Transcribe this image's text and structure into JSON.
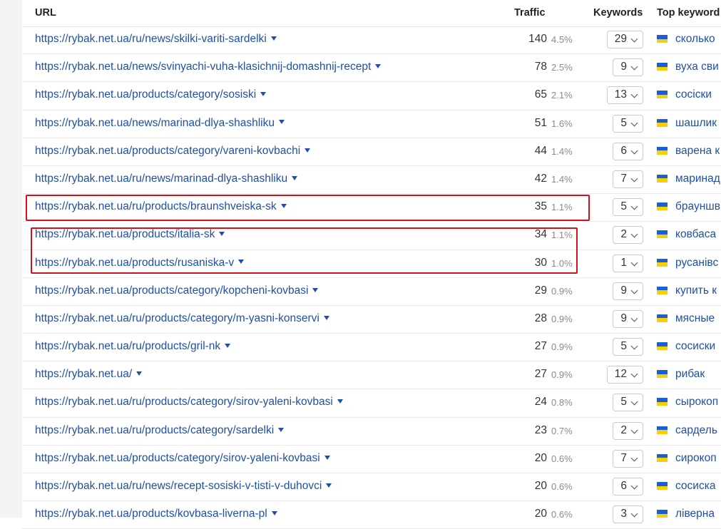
{
  "header": {
    "url": "URL",
    "traffic": "Traffic",
    "keywords": "Keywords",
    "top_keyword": "Top keyword"
  },
  "colors": {
    "link": "#1f4fa8",
    "highlight": "#d0121b",
    "flag_blue": "#1b5fd6",
    "flag_yellow": "#f7d000"
  },
  "rows": [
    {
      "url": "https://rybak.net.ua/ru/news/skilki-variti-sardelki",
      "traffic": "140",
      "pct": "4.5%",
      "keywords": "29",
      "top_keyword": "сколько"
    },
    {
      "url": "https://rybak.net.ua/news/svinyachi-vuha-klasichnij-domashnij-recept",
      "traffic": "78",
      "pct": "2.5%",
      "keywords": "9",
      "top_keyword": "вуха сви"
    },
    {
      "url": "https://rybak.net.ua/products/category/sosiski",
      "traffic": "65",
      "pct": "2.1%",
      "keywords": "13",
      "top_keyword": "сосіски"
    },
    {
      "url": "https://rybak.net.ua/news/marinad-dlya-shashliku",
      "traffic": "51",
      "pct": "1.6%",
      "keywords": "5",
      "top_keyword": "шашлик"
    },
    {
      "url": "https://rybak.net.ua/products/category/vareni-kovbachi",
      "traffic": "44",
      "pct": "1.4%",
      "keywords": "6",
      "top_keyword": "варена к"
    },
    {
      "url": "https://rybak.net.ua/ru/news/marinad-dlya-shashliku",
      "traffic": "42",
      "pct": "1.4%",
      "keywords": "7",
      "top_keyword": "маринад"
    },
    {
      "url": "https://rybak.net.ua/ru/products/braunshveiska-sk",
      "traffic": "35",
      "pct": "1.1%",
      "keywords": "5",
      "top_keyword": "брауншв"
    },
    {
      "url": "https://rybak.net.ua/products/italia-sk",
      "traffic": "34",
      "pct": "1.1%",
      "keywords": "2",
      "top_keyword": "ковбаса"
    },
    {
      "url": "https://rybak.net.ua/products/rusaniska-v",
      "traffic": "30",
      "pct": "1.0%",
      "keywords": "1",
      "top_keyword": "русанівс"
    },
    {
      "url": "https://rybak.net.ua/products/category/kopcheni-kovbasi",
      "traffic": "29",
      "pct": "0.9%",
      "keywords": "9",
      "top_keyword": "купить к"
    },
    {
      "url": "https://rybak.net.ua/ru/products/category/m-yasni-konservi",
      "traffic": "28",
      "pct": "0.9%",
      "keywords": "9",
      "top_keyword": "мясные"
    },
    {
      "url": "https://rybak.net.ua/ru/products/gril-nk",
      "traffic": "27",
      "pct": "0.9%",
      "keywords": "5",
      "top_keyword": "сосиски"
    },
    {
      "url": "https://rybak.net.ua/",
      "traffic": "27",
      "pct": "0.9%",
      "keywords": "12",
      "top_keyword": "рибак"
    },
    {
      "url": "https://rybak.net.ua/ru/products/category/sirov-yaleni-kovbasi",
      "traffic": "24",
      "pct": "0.8%",
      "keywords": "5",
      "top_keyword": "сырокоп"
    },
    {
      "url": "https://rybak.net.ua/ru/products/category/sardelki",
      "traffic": "23",
      "pct": "0.7%",
      "keywords": "2",
      "top_keyword": "сардель"
    },
    {
      "url": "https://rybak.net.ua/products/category/sirov-yaleni-kovbasi",
      "traffic": "20",
      "pct": "0.6%",
      "keywords": "7",
      "top_keyword": "сирокоп"
    },
    {
      "url": "https://rybak.net.ua/ru/news/recept-sosiski-v-tisti-v-duhovci",
      "traffic": "20",
      "pct": "0.6%",
      "keywords": "6",
      "top_keyword": "сосиска"
    },
    {
      "url": "https://rybak.net.ua/products/kovbasa-liverna-pl",
      "traffic": "20",
      "pct": "0.6%",
      "keywords": "3",
      "top_keyword": "ліверна"
    }
  ]
}
